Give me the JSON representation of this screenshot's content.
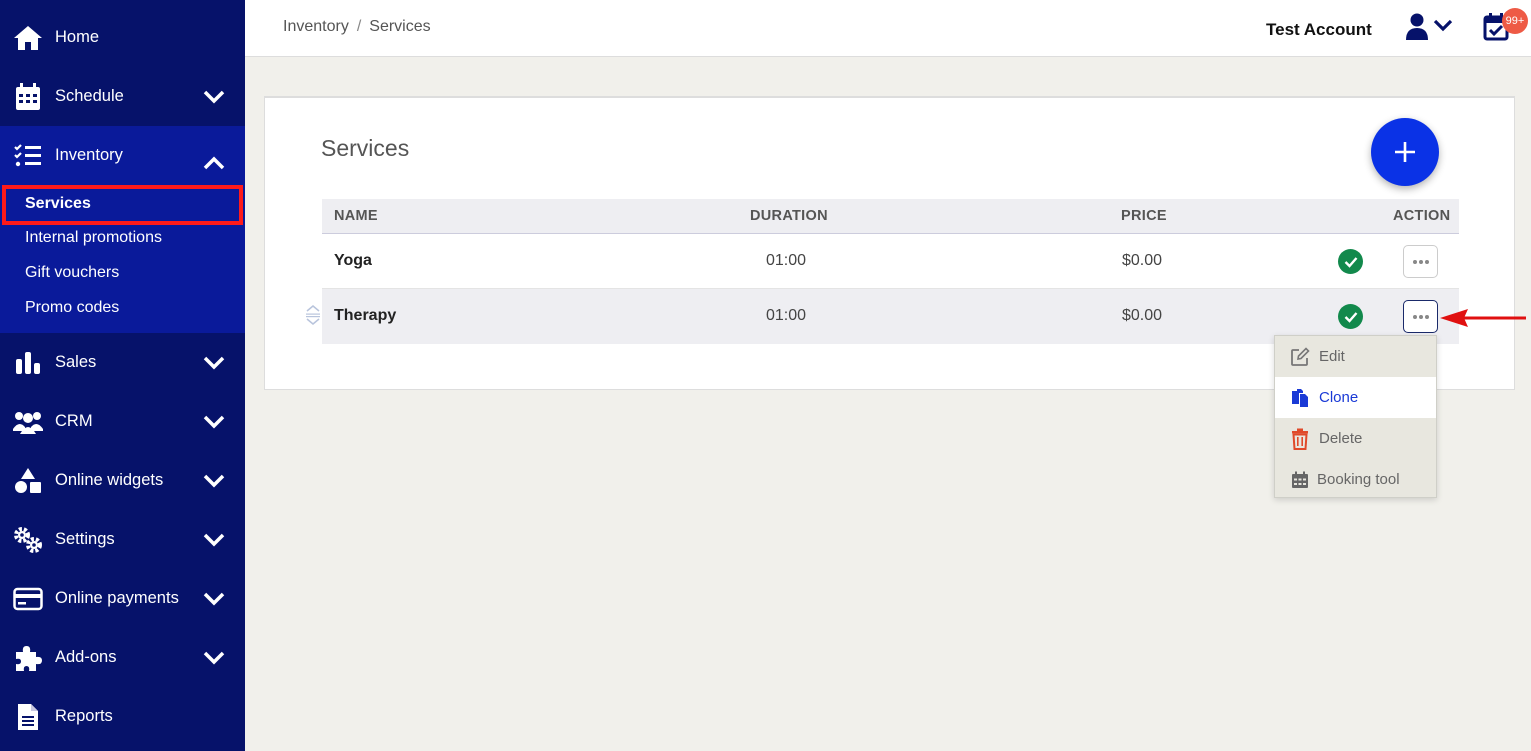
{
  "sidebar": {
    "items": [
      {
        "label": "Home",
        "icon": "home-icon"
      },
      {
        "label": "Schedule",
        "icon": "calendar-icon"
      },
      {
        "label": "Inventory",
        "icon": "checklist-icon"
      },
      {
        "label": "Sales",
        "icon": "bar-chart-icon"
      },
      {
        "label": "CRM",
        "icon": "users-icon"
      },
      {
        "label": "Online widgets",
        "icon": "shapes-icon"
      },
      {
        "label": "Settings",
        "icon": "gears-icon"
      },
      {
        "label": "Online payments",
        "icon": "credit-card-icon"
      },
      {
        "label": "Add-ons",
        "icon": "puzzle-icon"
      },
      {
        "label": "Reports",
        "icon": "document-icon"
      }
    ],
    "inventory_sub": [
      "Services",
      "Internal promotions",
      "Gift vouchers",
      "Promo codes"
    ]
  },
  "header": {
    "breadcrumb": [
      "Inventory",
      "Services"
    ],
    "breadcrumb_sep": "/",
    "account_name": "Test Account",
    "badge": "99+"
  },
  "main": {
    "title": "Services",
    "columns": [
      "NAME",
      "DURATION",
      "PRICE",
      "ACTION"
    ],
    "rows": [
      {
        "name": "Yoga",
        "duration": "01:00",
        "price": "$0.00"
      },
      {
        "name": "Therapy",
        "duration": "01:00",
        "price": "$0.00"
      }
    ],
    "menu": [
      "Edit",
      "Clone",
      "Delete",
      "Booking tool"
    ]
  },
  "colors": {
    "sidebar": "#06126a",
    "accent": "#0a32e6",
    "success": "#12894c",
    "danger": "#e04a2a",
    "highlight": "#ff1a1a"
  }
}
